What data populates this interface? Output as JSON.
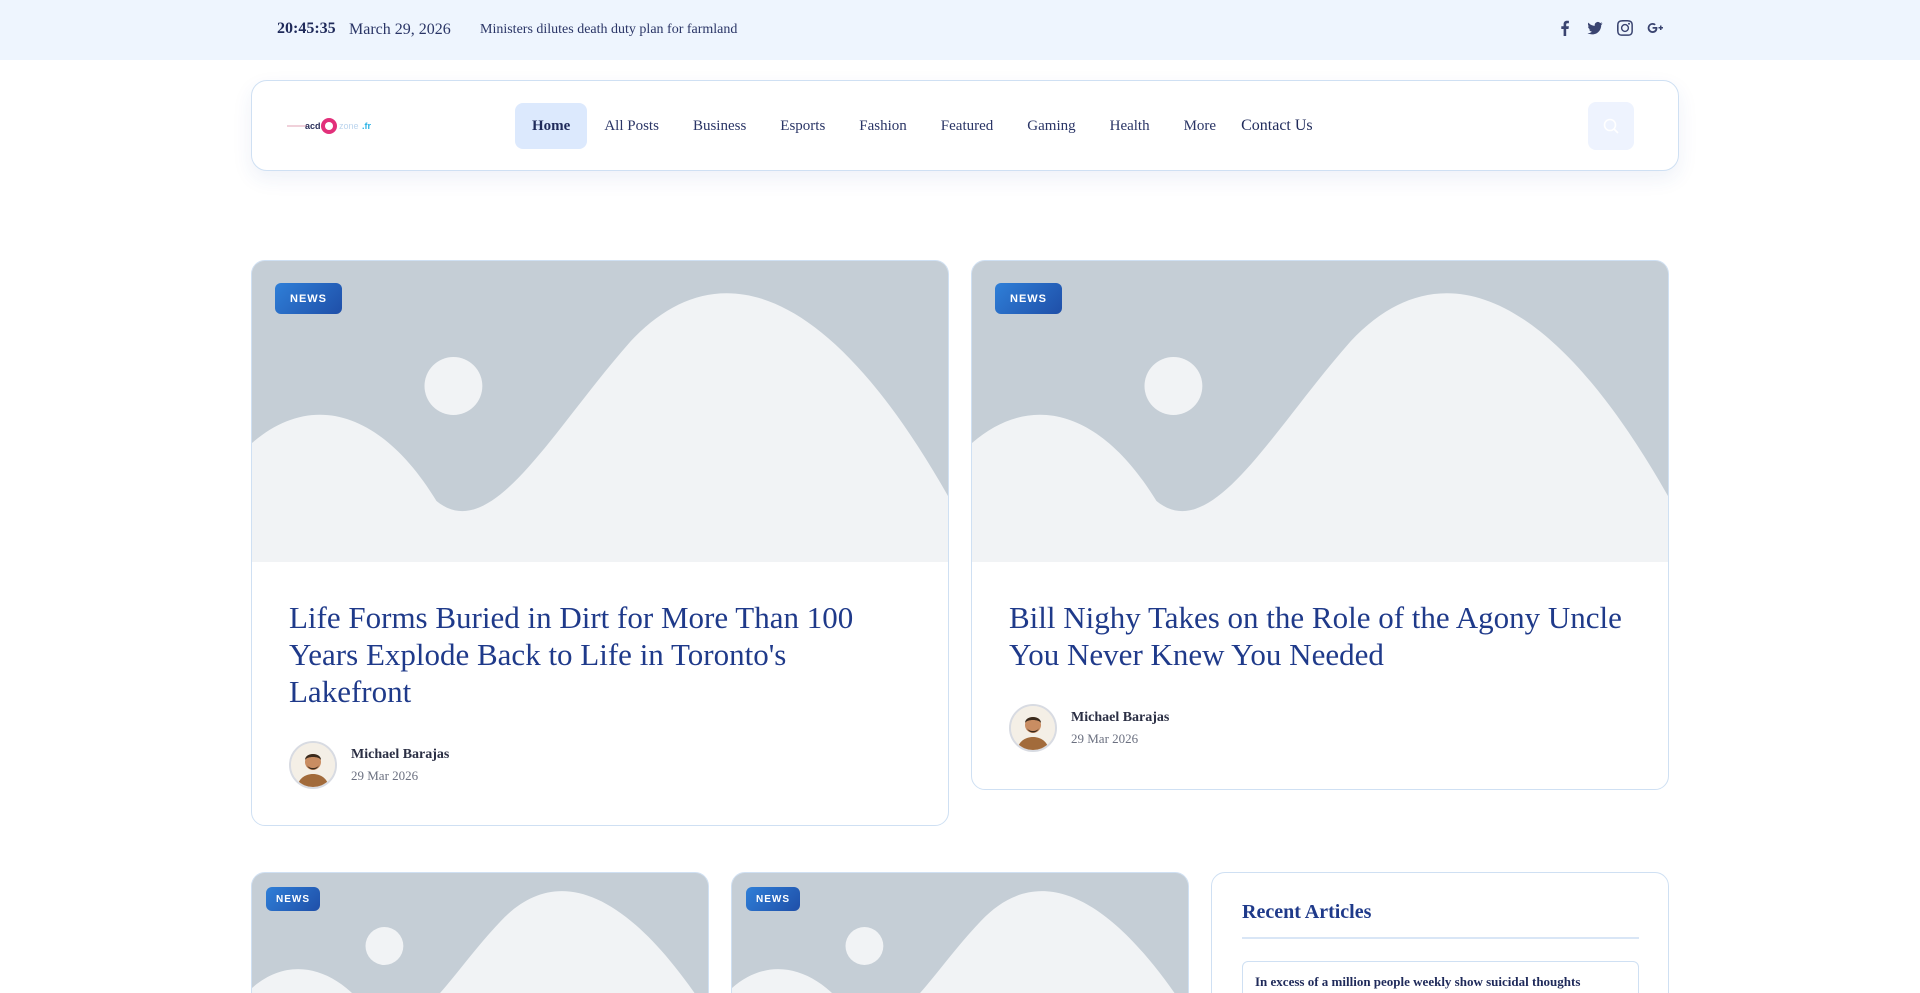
{
  "topbar": {
    "time": "20:45:35",
    "date": "March 29, 2026",
    "headline": "Ministers dilutes death duty plan for farmland",
    "social_icons": [
      "facebook-icon",
      "twitter-icon",
      "instagram-icon",
      "google-plus-icon"
    ]
  },
  "nav": {
    "logo_text": "acd-zone.fr",
    "items": [
      "Home",
      "All Posts",
      "Business",
      "Esports",
      "Fashion",
      "Featured",
      "Gaming",
      "Health",
      "More",
      "Contact Us"
    ],
    "active": "Home"
  },
  "featured": [
    {
      "badge": "NEWS",
      "title": "Life Forms Buried in Dirt for More Than 100 Years Explode Back to Life in Toronto's Lakefront",
      "author": "Michael Barajas",
      "date": "29 Mar 2026"
    },
    {
      "badge": "NEWS",
      "title": "Bill Nighy Takes on the Role of the Agony Uncle You Never Knew You Needed",
      "author": "Michael Barajas",
      "date": "29 Mar 2026"
    }
  ],
  "grid": [
    {
      "badge": "NEWS"
    },
    {
      "badge": "NEWS"
    }
  ],
  "sidebar": {
    "heading": "Recent Articles",
    "items": [
      "In excess of a million people weekly show suicidal thoughts"
    ]
  },
  "colors": {
    "topbar_bg": "#eef5fe",
    "title_blue": "#1f3a8a",
    "badge_blue": "#1f4fa8",
    "active_nav_bg": "#dce9fd"
  }
}
